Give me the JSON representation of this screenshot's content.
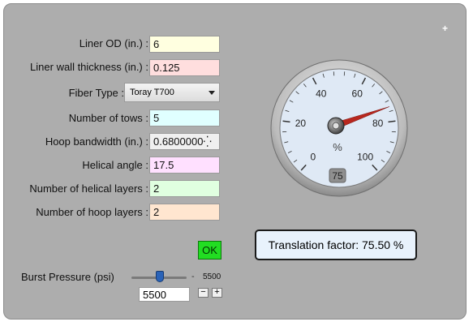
{
  "form": {
    "fields": [
      {
        "label": "Liner OD (in.) :",
        "value": "6",
        "color": "#ffffe0"
      },
      {
        "label": "Liner wall thickness (in.) :",
        "value": "0.125",
        "color": "#ffdede"
      },
      {
        "label": "Fiber Type :",
        "value": "Toray T700",
        "type": "select"
      },
      {
        "label": "Number of tows :",
        "value": "5",
        "color": "#e0ffff"
      },
      {
        "label": "Hoop bandwidth (in.) :",
        "value": "0.6800000⁛",
        "color": "#f0f0f0"
      },
      {
        "label": "Helical angle :",
        "value": "17.5",
        "color": "#ffe0ff"
      },
      {
        "label": "Number of helical layers :",
        "value": "2",
        "color": "#e0ffe0"
      },
      {
        "label": "Number of hoop layers :",
        "value": "2",
        "color": "#ffe6d0"
      }
    ],
    "ok_label": "OK"
  },
  "gauge": {
    "ticks": [
      "0",
      "20",
      "40",
      "60",
      "80",
      "100"
    ],
    "unit": "%",
    "value_display": "75",
    "value": 75.5,
    "min": 0,
    "max": 100
  },
  "translation": {
    "text": "Translation factor: 75.50 %"
  },
  "burst": {
    "label": "Burst Pressure (psi)",
    "slider_value": "5500",
    "input_value": "5500",
    "dash": "-",
    "minus": "−",
    "plus": "+"
  },
  "corner_mark": "+"
}
